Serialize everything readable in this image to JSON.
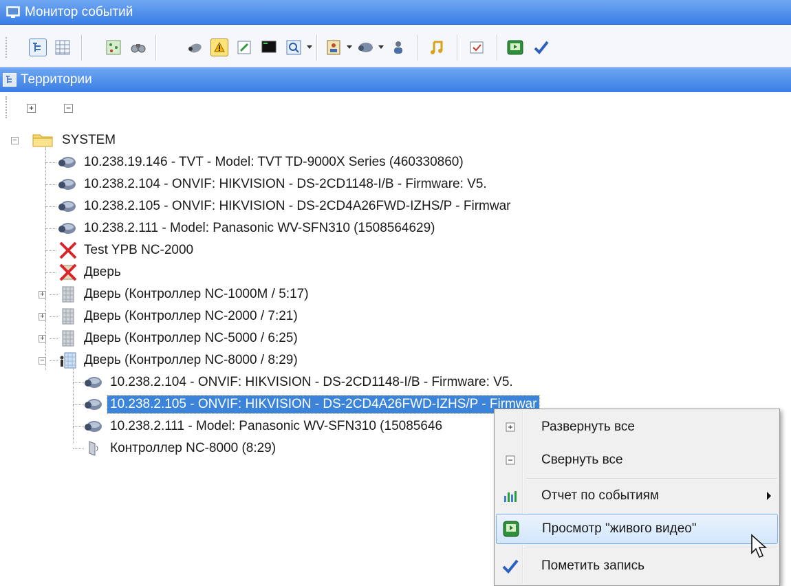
{
  "window": {
    "title": "Монитор событий"
  },
  "toolbar": {
    "icons": [
      "tree-view-icon",
      "grid-view-icon",
      "map-icon",
      "binoculars-icon",
      "camera-icon",
      "alarm-icon",
      "edit-icon",
      "monitor-icon",
      "search-window-icon",
      "person-card-icon",
      "camera-dropdown-icon",
      "users-icon",
      "music-note-icon",
      "checkbox-icon",
      "live-video-icon",
      "checkmark-icon"
    ]
  },
  "section": {
    "title": "Территории"
  },
  "subtoolbar": {
    "expand_label": "+",
    "collapse_label": "−"
  },
  "tree": {
    "root": "SYSTEM",
    "items": [
      "10.238.19.146 - TVT - Model: TVT TD-9000X Series (460330860)",
      "10.238.2.104 - ONVIF: HIKVISION - DS-2CD1148-I/B - Firmware: V5.",
      "10.238.2.105 - ONVIF: HIKVISION - DS-2CD4A26FWD-IZHS/P - Firmwar",
      "10.238.2.111 - Model: Panasonic WV-SFN310 (1508564629)",
      "Test YPB NC-2000",
      "Дверь",
      "Дверь (Контроллер NC-1000M / 5:17)",
      "Дверь (Контроллер NC-2000 / 7:21)",
      "Дверь (Контроллер NC-5000 / 6:25)",
      "Дверь (Контроллер NC-8000 / 8:29)"
    ],
    "children": [
      "10.238.2.104 - ONVIF: HIKVISION - DS-2CD1148-I/B - Firmware: V5.",
      "10.238.2.105 - ONVIF: HIKVISION - DS-2CD4A26FWD-IZHS/P - Firmwar",
      "10.238.2.111 - Model: Panasonic WV-SFN310 (15085646",
      "Контроллер NC-8000 (8:29)"
    ]
  },
  "context_menu": {
    "items": [
      {
        "label": "Развернуть все",
        "icon": "expand-icon"
      },
      {
        "label": "Свернуть все",
        "icon": "collapse-icon"
      },
      {
        "label": "Отчет по событиям",
        "icon": "chart-report-icon"
      },
      {
        "label": "Просмотр \"живого видео\"",
        "icon": "live-video-icon"
      },
      {
        "label": "Пометить запись",
        "icon": "checkmark-icon"
      }
    ]
  },
  "colors": {
    "titlebar": "#3a7ee5",
    "selection": "#3b84d9",
    "menu_hover_border": "#7aaee6"
  }
}
